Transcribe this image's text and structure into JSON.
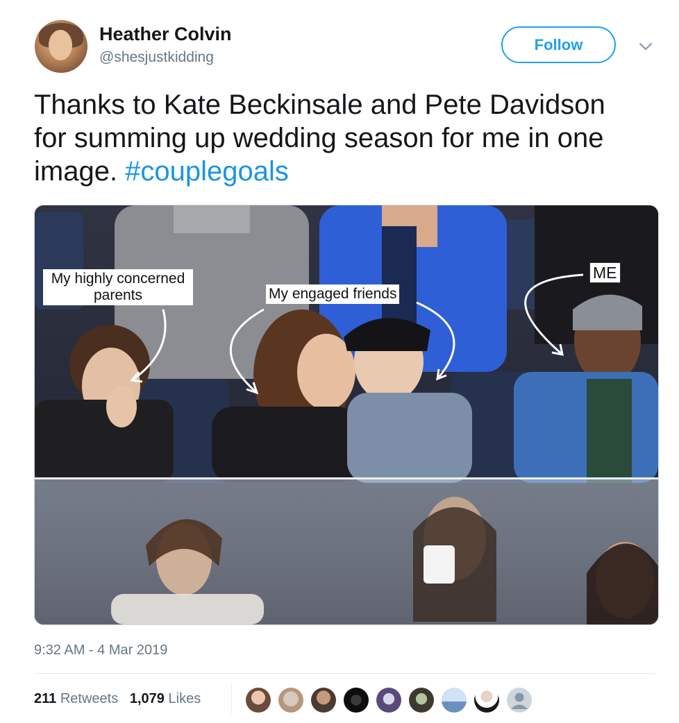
{
  "tweet": {
    "author": {
      "name": "Heather Colvin",
      "handle": "@shesjustkidding",
      "avatar_icon": "user-avatar-photo"
    },
    "follow_label": "Follow",
    "menu_icon": "chevron-down-icon",
    "text_main": "Thanks to Kate Beckinsale and Pete Davidson for summing up wedding season for me in one image. ",
    "hashtag": "#couplegoals",
    "media": {
      "labels": {
        "parents": "My highly concerned parents",
        "friends": "My engaged friends",
        "me": "ME"
      }
    },
    "timestamp": "9:32 AM - 4 Mar 2019",
    "stats": {
      "retweets_count": "211",
      "retweets_label": "Retweets",
      "likes_count": "1,079",
      "likes_label": "Likes"
    },
    "likers_count": 9
  },
  "colors": {
    "accent": "#1da1f2",
    "hashtag": "#1b95e0",
    "muted": "#657786",
    "text": "#14171a",
    "divider": "#e6ecf0"
  }
}
